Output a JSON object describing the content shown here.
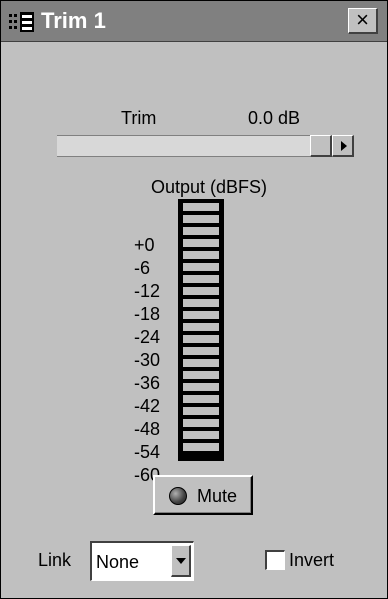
{
  "window": {
    "title": "Trim 1",
    "close_glyph": "×"
  },
  "trim": {
    "label": "Trim",
    "value": "0.0 dB",
    "slider_fraction": 1.0
  },
  "meter": {
    "title": "Output (dBFS)",
    "ticks": [
      "+0",
      "-6",
      "-12",
      "-18",
      "-24",
      "-30",
      "-36",
      "-42",
      "-48",
      "-54",
      "-60"
    ],
    "segment_count": 21,
    "level_fraction": 0.0
  },
  "mute": {
    "label": "Mute"
  },
  "link": {
    "label": "Link",
    "value": "None"
  },
  "invert": {
    "label": "Invert",
    "checked": false
  },
  "icons": {
    "app": "mixer-channel-icon",
    "close": "close-icon",
    "led": "mute-led-icon"
  }
}
